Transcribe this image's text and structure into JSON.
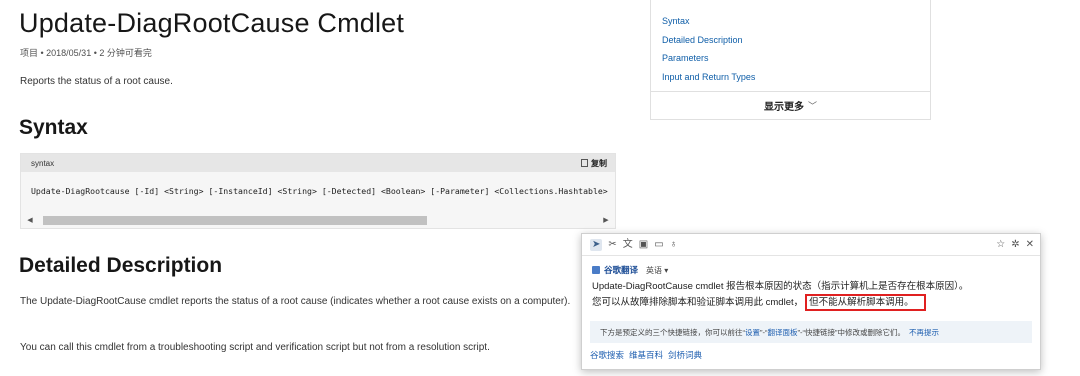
{
  "article": {
    "title": "Update-DiagRootCause Cmdlet",
    "meta": "项目 • 2018/05/31 • 2 分钟可看完",
    "summary": "Reports the status of a root cause.",
    "syntax_heading": "Syntax",
    "code": {
      "lang_label": "syntax",
      "copy_label": "复制",
      "text": "Update-DiagRootcause [-Id] <String> [-InstanceId] <String> [-Detected] <Boolean> [-Parameter] <Collections.Hashtable>"
    },
    "detailed_heading": "Detailed Description",
    "para1": "The Update-DiagRootCause cmdlet reports the status of a root cause (indicates whether a root cause exists on a computer).",
    "para2": "You can call this cmdlet from a troubleshooting script and verification script but not from a resolution script."
  },
  "toc": {
    "items": [
      "Syntax",
      "Detailed Description",
      "Parameters",
      "Input and Return Types"
    ],
    "more_label": "显示更多",
    "more_icon": "chevron-down-icon"
  },
  "popup": {
    "toolbar_icons_left": [
      "pointer-icon",
      "scissors-icon",
      "translate-icon",
      "screen-icon",
      "image-icon",
      "microphone-icon"
    ],
    "toolbar_icons_right": [
      "star-icon",
      "gear-icon",
      "close-icon"
    ],
    "provider_name": "谷歌翻译",
    "provider_lang": "英语 ▾",
    "line1": "Update-DiagRootCause cmdlet 报告根本原因的状态（指示计算机上是否存在根本原因）。",
    "line2_prefix": "您可以从故障排除脚本和验证脚本调用此 cmdlet，",
    "line2_highlight": "但不能从解析脚本调用。",
    "notice_prefix": "下方是预定义的三个快捷链接，你可以前往“",
    "notice_link1": "设置",
    "notice_mid1": "”-“",
    "notice_link2": "翻译面板",
    "notice_mid2": "”-“快捷链接”中修改或删除它们。",
    "notice_hide": "不再提示",
    "links": [
      "谷歌搜索",
      "维基百科",
      "剑桥词典"
    ]
  },
  "colors": {
    "link": "#0f5ea8",
    "highlight_border": "#e02020",
    "notice_bg": "#eef3f8"
  }
}
